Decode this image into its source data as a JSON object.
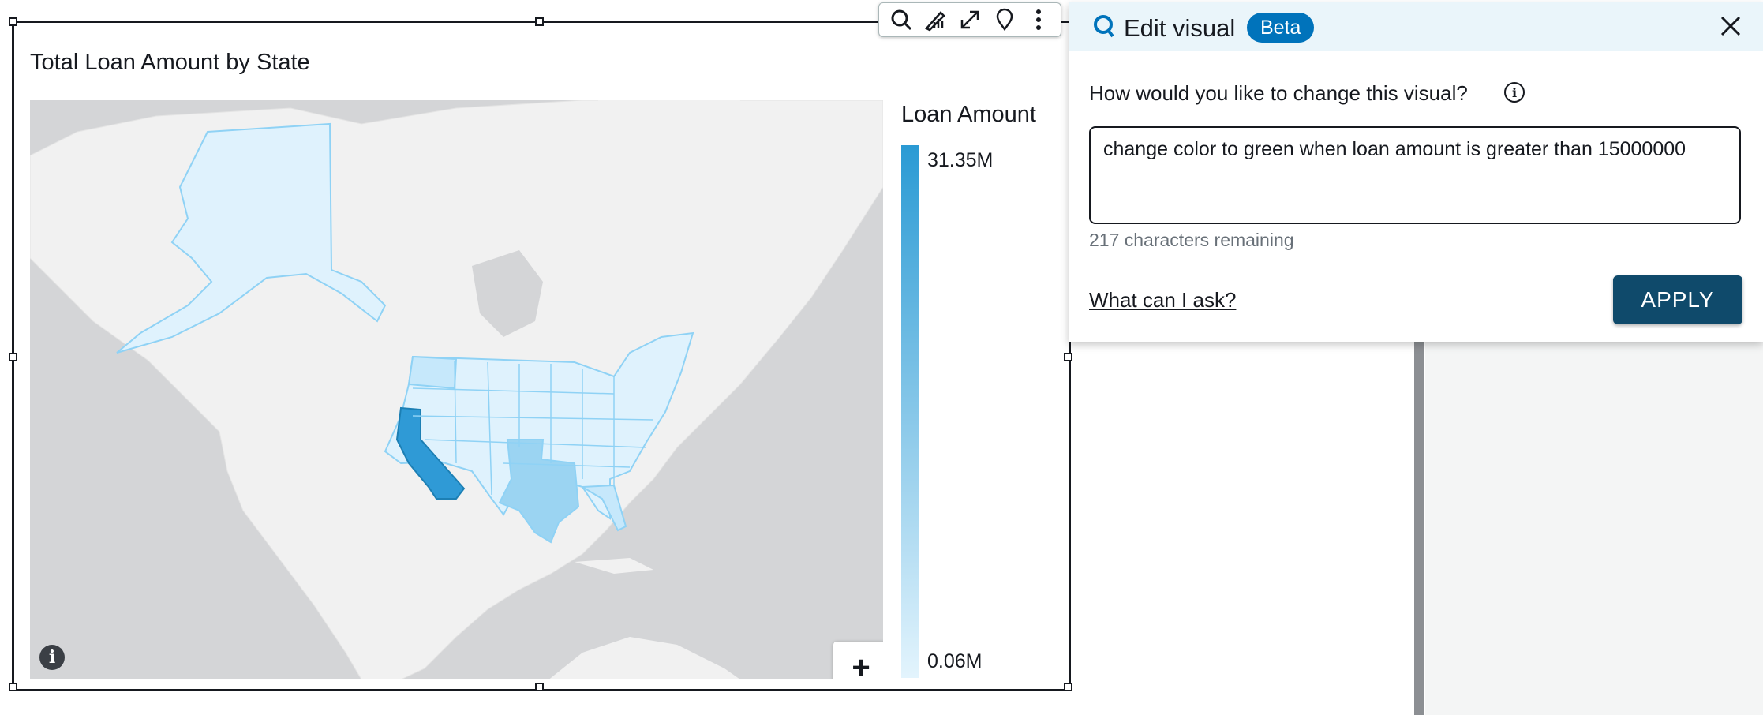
{
  "visual": {
    "title": "Total Loan Amount by State",
    "legend": {
      "title": "Loan Amount",
      "max_label": "31.35M",
      "min_label": "0.06M",
      "color_high": "#2a9ad4",
      "color_low": "#e3f4fd"
    },
    "zoom": {
      "in_label": "+",
      "out_label": "−"
    }
  },
  "toolbar": {
    "icons": [
      "search-icon",
      "format-icon",
      "expand-icon",
      "pin-icon",
      "more-options-icon"
    ]
  },
  "edit_panel": {
    "title": "Edit visual",
    "badge": "Beta",
    "question": "How would you like to change this visual?",
    "prompt_value": "change color to green when loan amount is greater than 15000000",
    "char_count": "217 characters remaining",
    "help_link": "What can I ask?",
    "apply_label": "APPLY",
    "accent_color": "#0073bb",
    "button_color": "#0f4a6b"
  }
}
